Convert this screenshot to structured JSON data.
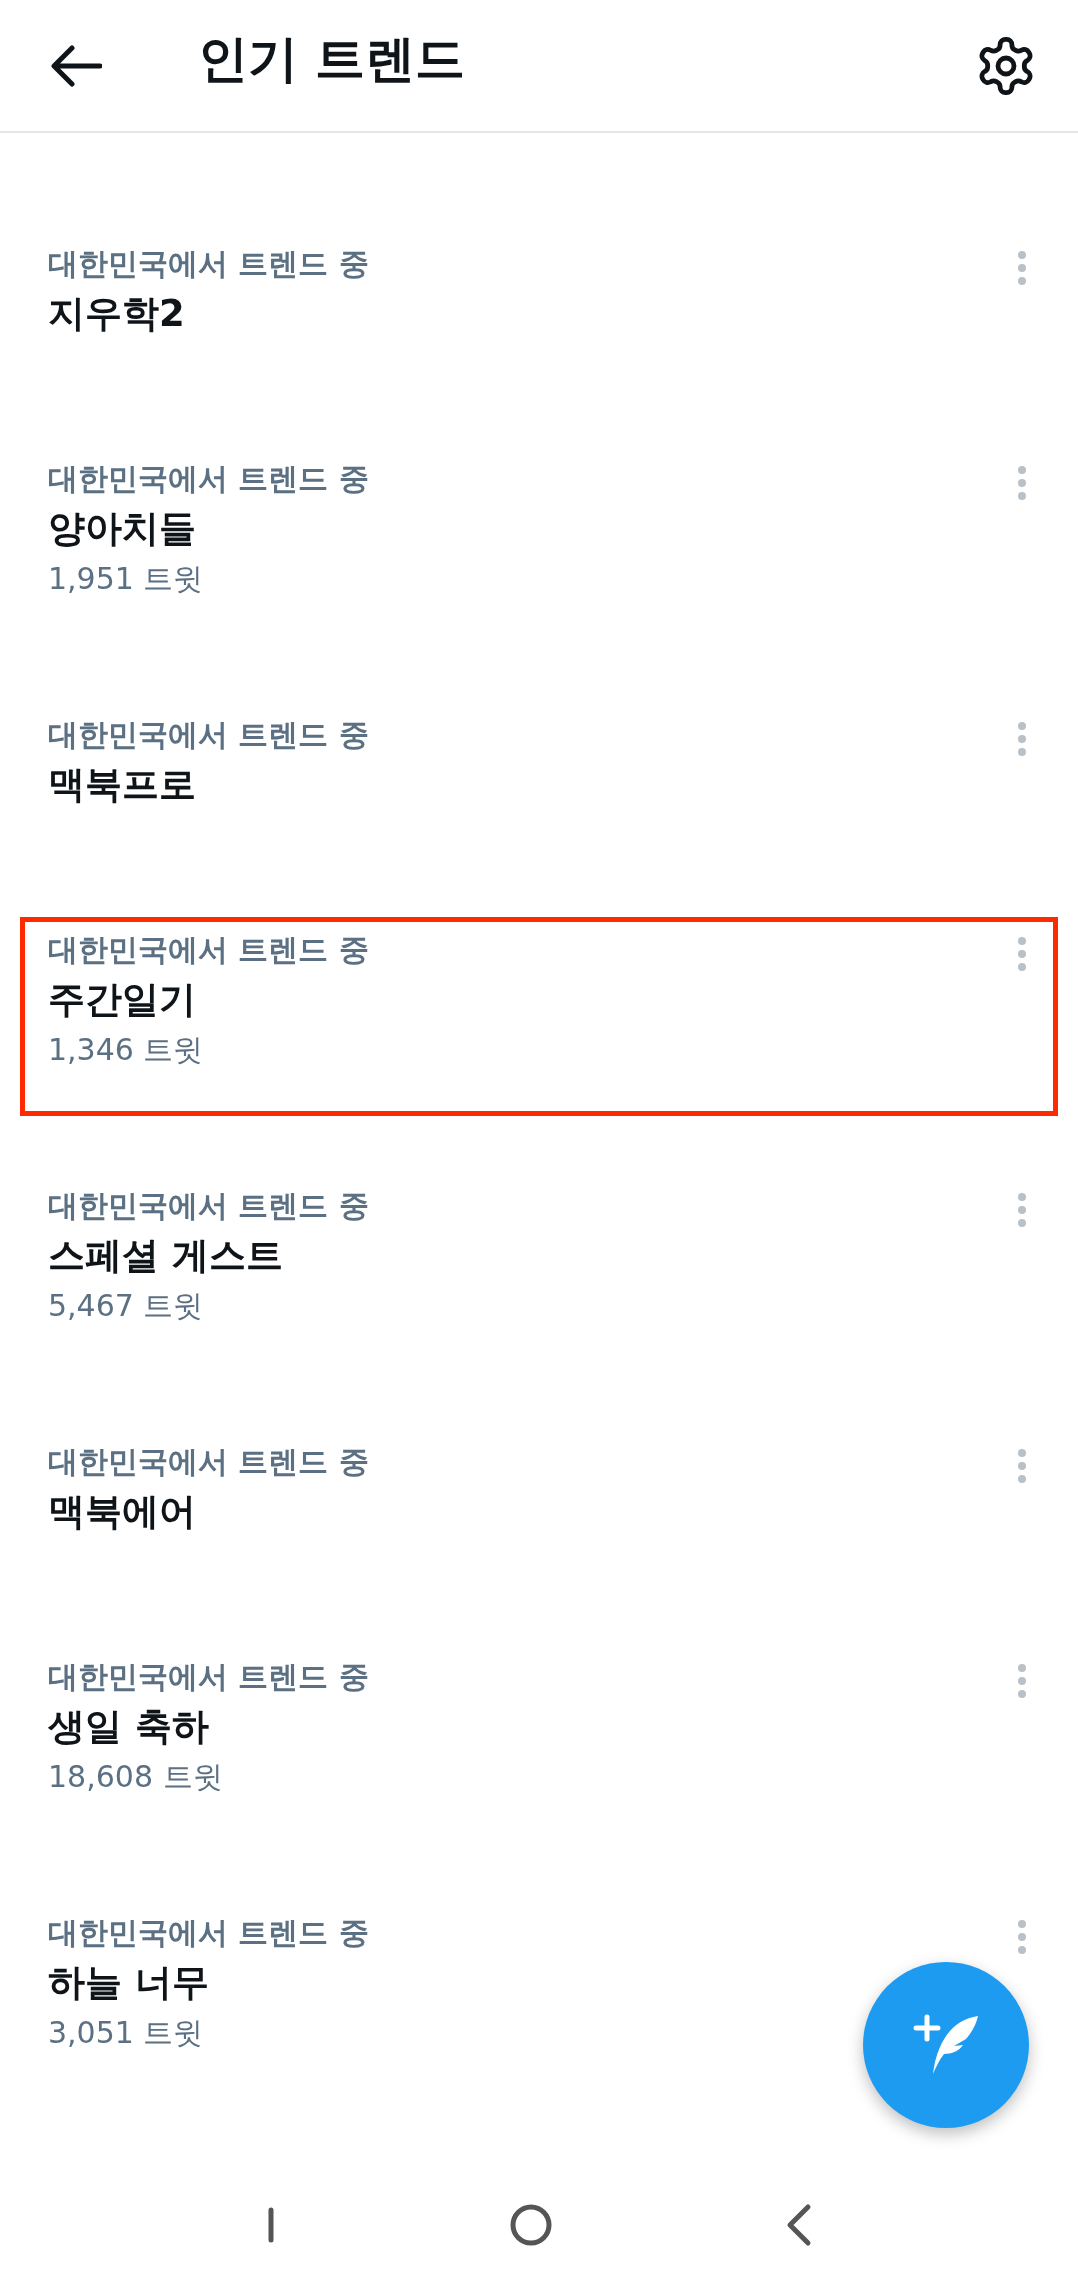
{
  "header": {
    "title": "인기 트렌드"
  },
  "trends": [
    {
      "category": "대한민국에서 트렌드 중",
      "name": "지우학2",
      "highlighted": false
    },
    {
      "category": "대한민국에서 트렌드 중",
      "name": "양아치들",
      "count": "1,951 트윗",
      "highlighted": false
    },
    {
      "category": "대한민국에서 트렌드 중",
      "name": "맥북프로",
      "highlighted": false
    },
    {
      "category": "대한민국에서 트렌드 중",
      "name": "주간일기",
      "count": "1,346 트윗",
      "highlighted": true
    },
    {
      "category": "대한민국에서 트렌드 중",
      "name": "스페셜 게스트",
      "count": "5,467 트윗",
      "highlighted": false
    },
    {
      "category": "대한민국에서 트렌드 중",
      "name": "맥북에어",
      "highlighted": false
    },
    {
      "category": "대한민국에서 트렌드 중",
      "name": "생일 축하",
      "count": "18,608 트윗",
      "highlighted": false
    },
    {
      "category": "대한민국에서 트렌드 중",
      "name": "하늘 너무",
      "count": "3,051 트윗",
      "highlighted": false
    }
  ]
}
